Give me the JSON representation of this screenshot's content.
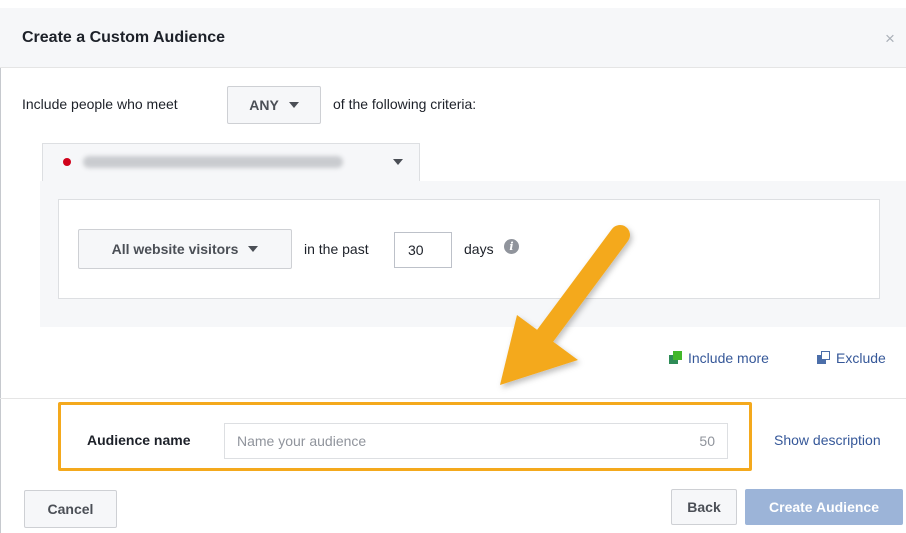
{
  "dialog": {
    "title": "Create a Custom Audience",
    "close_icon": "close-icon",
    "close_glyph": "×"
  },
  "criteria": {
    "prefix": "Include people who meet",
    "match_value": "ANY",
    "suffix": "of the following criteria:"
  },
  "pixel": {
    "status_color": "#d0021b"
  },
  "rule": {
    "visitors_option": "All website visitors",
    "in_the_past": "in the past",
    "days_value": "30",
    "days_label": "days",
    "info_glyph": "i"
  },
  "actions": {
    "include_more": "Include more",
    "exclude": "Exclude"
  },
  "audience_name": {
    "label": "Audience name",
    "placeholder": "Name your audience",
    "char_remaining": "50",
    "show_description": "Show description"
  },
  "footer": {
    "cancel": "Cancel",
    "back": "Back",
    "create": "Create Audience"
  },
  "colors": {
    "link": "#365899",
    "highlight": "#f4a91d",
    "primary_disabled": "#9cb4d8",
    "include_icon": "#42b72a",
    "exclude_icon": "#365899"
  }
}
